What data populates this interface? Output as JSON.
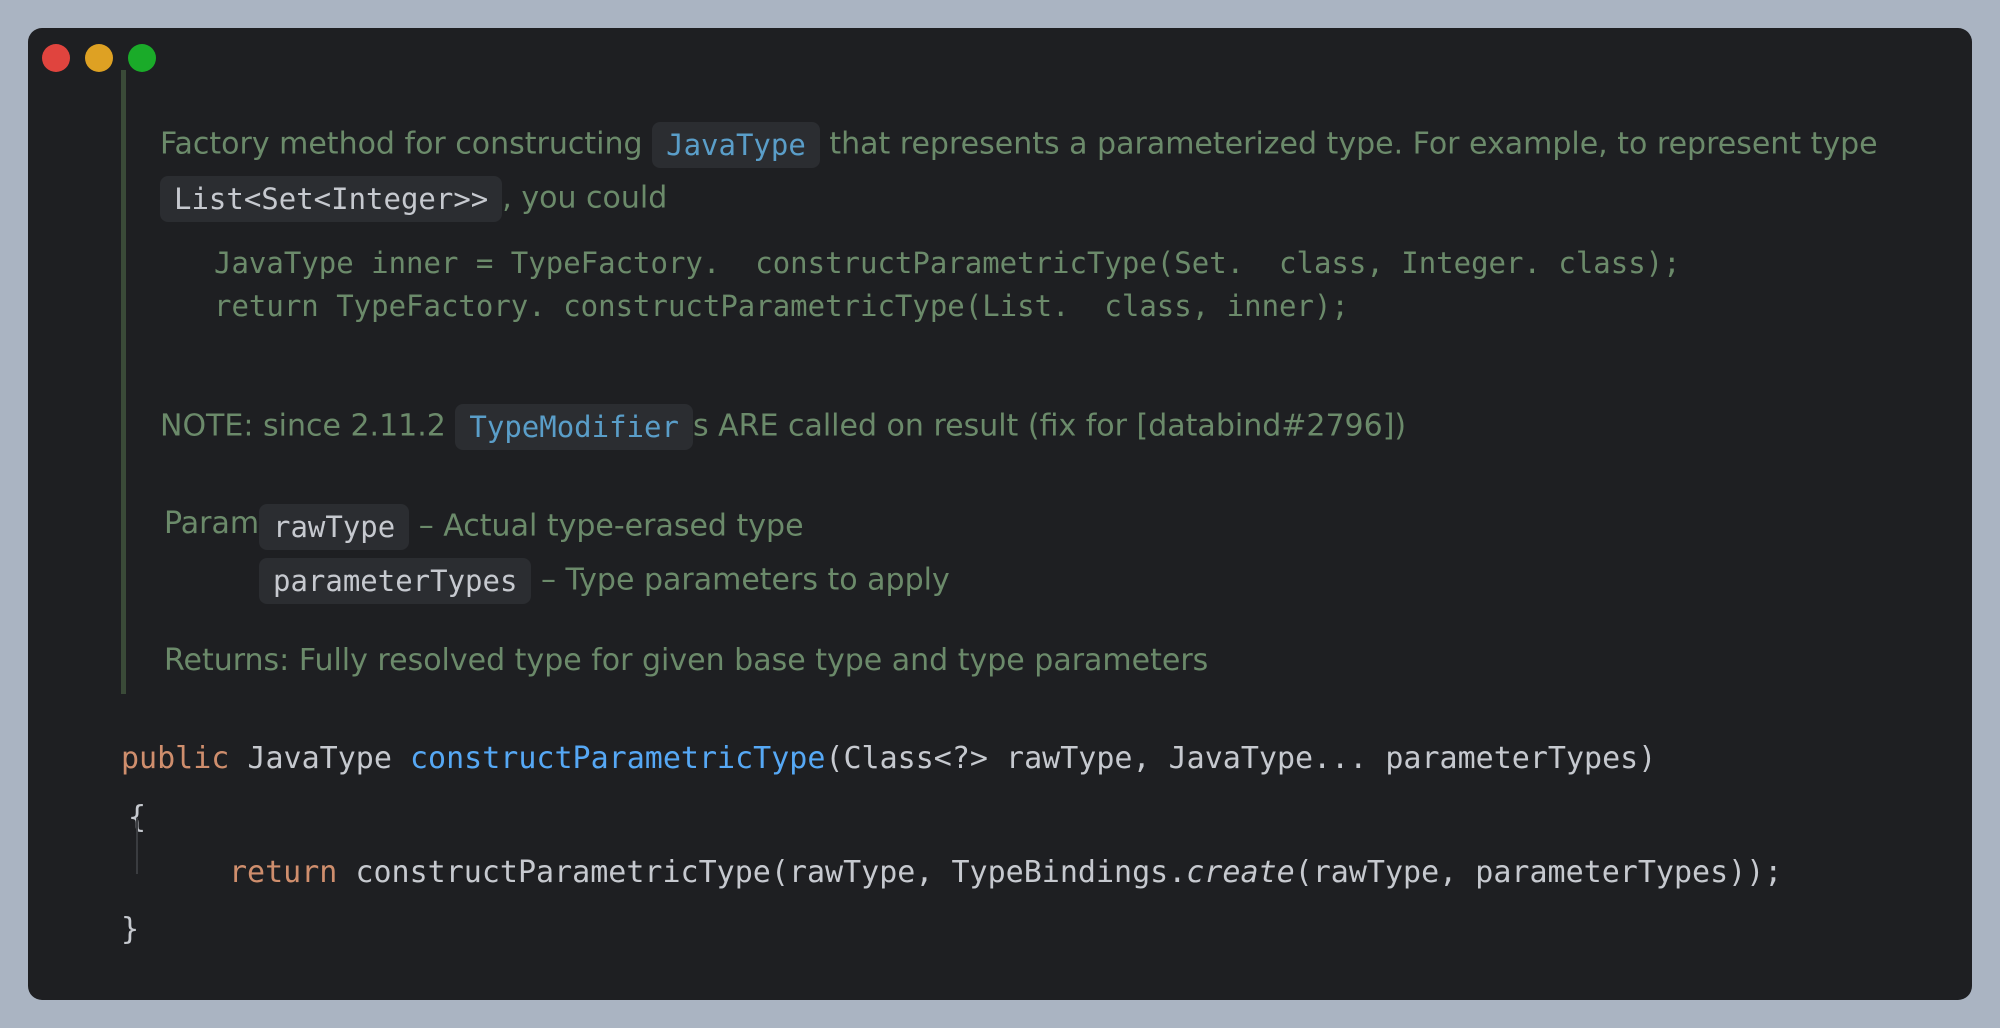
{
  "doc": {
    "line1_before": "Factory method for constructing",
    "line1_chip": "JavaType",
    "line1_after": "that represents a parameterized type. For example, to represent type",
    "line2_chip": "List<Set<Integer>>",
    "line2_after": ", you could",
    "example_line1": "JavaType inner = TypeFactory.  constructParametricType(Set.  class, Integer. class);",
    "example_line2": "return TypeFactory. constructParametricType(List.  class, inner);",
    "note_before": "NOTE: since 2.11.2",
    "note_chip": "TypeModifier",
    "note_after": "s ARE called on result (fix for [databind#2796])",
    "params_label": "Params:",
    "param1_name": "rawType",
    "param1_desc": "– Actual type-erased type",
    "param2_name": "parameterTypes",
    "param2_desc": "– Type parameters to apply",
    "returns_label": "Returns:",
    "returns_desc": "Fully resolved type for given base type and type parameters"
  },
  "code": {
    "sig_kw": "public",
    "sig_type": "JavaType",
    "sig_method": "constructParametricType",
    "sig_params": "(Class<?> rawType, JavaType... parameterTypes)",
    "open_brace": "{",
    "ret_kw": "return",
    "ret_call": "constructParametricType(rawType, TypeBindings.",
    "ret_italic": "create",
    "ret_tail": "(rawType, parameterTypes));",
    "close_brace": "}"
  },
  "colors": {
    "background": "#aab4c2",
    "editor": "#1e1f22",
    "doc_text": "#6b8a6a",
    "keyword": "#cf8e6d",
    "method": "#56a8f5",
    "link": "#5a9ec9"
  }
}
